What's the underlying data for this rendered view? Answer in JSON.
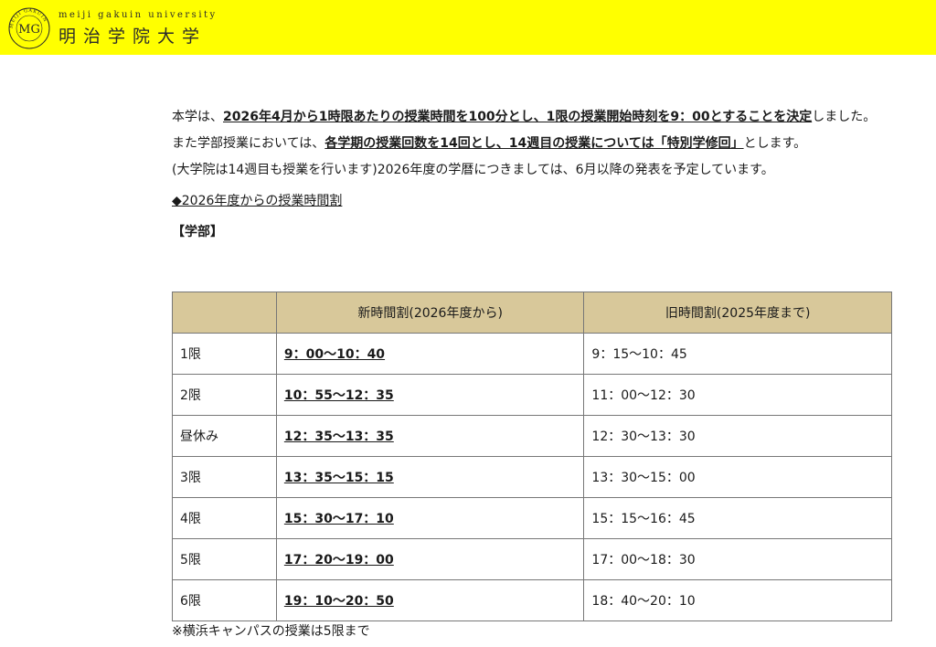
{
  "header": {
    "bg_color": "#ffff00",
    "logo_en": "meiji gakuin university",
    "logo_ja": "明治学院大学",
    "seal_monogram": "MG",
    "seal_ring_text": "MEIJI GAKUIN"
  },
  "intro": {
    "p1_a": "本学は、",
    "p1_b": "2026年4月から1時限あたりの授業時間を100分とし、1限の授業開始時刻を9：00とすることを決定",
    "p1_c": "しました。",
    "p2_a": "また学部授業においては、",
    "p2_b": "各学期の授業回数を14回とし、14週目の授業については「特別学修回」",
    "p2_c": "とします。",
    "p3": "(大学院は14週目も授業を行います)2026年度の学暦につきましては、6月以降の発表を予定しています。"
  },
  "section_link": "◆2026年度からの授業時間割",
  "subheading": "【学部】",
  "table": {
    "header_color": "#d8c89a",
    "columns": [
      "",
      "新時間割(2026年度から)",
      "旧時間割(2025年度まで)"
    ],
    "rows": [
      {
        "period": "1限",
        "new": "9：00〜10：40",
        "old": "9：15〜10：45"
      },
      {
        "period": "2限",
        "new": "10：55〜12：35",
        "old": "11：00〜12：30"
      },
      {
        "period": "昼休み",
        "new": "12：35〜13：35",
        "old": "12：30〜13：30"
      },
      {
        "period": "3限",
        "new": "13：35〜15：15",
        "old": "13：30〜15：00"
      },
      {
        "period": "4限",
        "new": "15：30〜17：10",
        "old": "15：15〜16：45"
      },
      {
        "period": "5限",
        "new": "17：20〜19：00",
        "old": "17：00〜18：30"
      },
      {
        "period": "6限",
        "new": "19：10〜20：50",
        "old": "18：40〜20：10"
      }
    ]
  },
  "footnote": "※横浜キャンパスの授業は5限まで"
}
